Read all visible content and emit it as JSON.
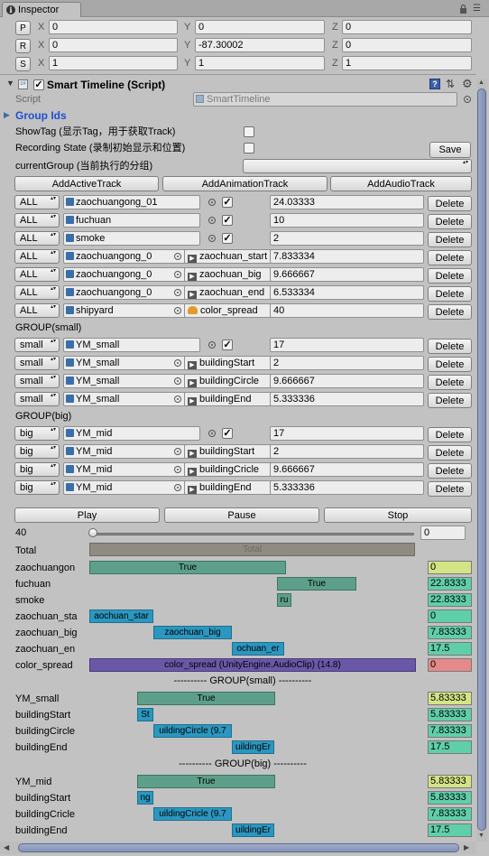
{
  "window": {
    "tab_title": "Inspector"
  },
  "transform": {
    "rows": [
      {
        "button": "P",
        "x": "0",
        "y": "0",
        "z": "0"
      },
      {
        "button": "R",
        "x": "0",
        "y": "-87.30002",
        "z": "0"
      },
      {
        "button": "S",
        "x": "1",
        "y": "1",
        "z": "1"
      }
    ],
    "x_label": "X",
    "y_label": "Y",
    "z_label": "Z"
  },
  "component": {
    "title": "Smart Timeline (Script)",
    "script_label": "Script",
    "script_value": "SmartTimeline",
    "group_ids_label": "Group Ids",
    "show_tag_label": "ShowTag (显示Tag，用于获取Track)",
    "recording_label": "Recording State (录制初始显示和位置)",
    "save_label": "Save",
    "current_group_label": "currentGroup (当前执行的分组)",
    "current_group_value": ""
  },
  "add_buttons": [
    "AddActiveTrack",
    "AddAnimationTrack",
    "AddAudioTrack"
  ],
  "delete_label": "Delete",
  "tracks_all": [
    {
      "group": "ALL",
      "object": "zaochuangong_01",
      "checked": true,
      "clip": "",
      "value": "24.03333"
    },
    {
      "group": "ALL",
      "object": "fuchuan",
      "checked": true,
      "clip": "",
      "value": "10"
    },
    {
      "group": "ALL",
      "object": "smoke",
      "checked": true,
      "clip": "",
      "value": "2"
    },
    {
      "group": "ALL",
      "object": "zaochuangong_0",
      "clip": "zaochuan_start",
      "value": "7.833334",
      "kind": "anim"
    },
    {
      "group": "ALL",
      "object": "zaochuangong_0",
      "clip": "zaochuan_big",
      "value": "9.666667",
      "kind": "anim"
    },
    {
      "group": "ALL",
      "object": "zaochuangong_0",
      "clip": "zaochuan_end",
      "value": "6.533334",
      "kind": "anim"
    },
    {
      "group": "ALL",
      "object": "shipyard",
      "clip": "color_spread",
      "value": "40",
      "kind": "audio"
    }
  ],
  "group_small_title": "GROUP(small)",
  "tracks_small": [
    {
      "group": "small",
      "object": "YM_small",
      "checked": true,
      "value": "17"
    },
    {
      "group": "small",
      "object": "YM_small",
      "clip": "buildingStart",
      "value": "2",
      "kind": "anim"
    },
    {
      "group": "small",
      "object": "YM_small",
      "clip": "buildingCircle",
      "value": "9.666667",
      "kind": "anim"
    },
    {
      "group": "small",
      "object": "YM_small",
      "clip": "buildingEnd",
      "value": "5.333336",
      "kind": "anim"
    }
  ],
  "group_big_title": "GROUP(big)",
  "tracks_big": [
    {
      "group": "big",
      "object": "YM_mid",
      "checked": true,
      "value": "17"
    },
    {
      "group": "big",
      "object": "YM_mid",
      "clip": "buildingStart",
      "value": "2",
      "kind": "anim"
    },
    {
      "group": "big",
      "object": "YM_mid",
      "clip": "buildingCricle",
      "value": "9.666667",
      "kind": "anim"
    },
    {
      "group": "big",
      "object": "YM_mid",
      "clip": "buildingEnd",
      "value": "5.333336",
      "kind": "anim"
    }
  ],
  "controls": {
    "play": "Play",
    "pause": "Pause",
    "stop": "Stop",
    "time_label": "40",
    "time_value": "0"
  },
  "timeline": {
    "total_label": "Total",
    "total_bar": "Total",
    "rows_all": [
      {
        "label": "zaochuangon",
        "bar": "True",
        "value": "0"
      },
      {
        "label": "fuchuan",
        "bar": "True",
        "value": "22.8333"
      },
      {
        "label": "smoke",
        "bar": "ru",
        "value": "22.8333"
      },
      {
        "label": "zaochuan_sta",
        "bar": "aochuan_star",
        "value": "0"
      },
      {
        "label": "zaochuan_big",
        "bar": "zaochuan_big",
        "value": "7.83333"
      },
      {
        "label": "zaochuan_en",
        "bar": "ochuan_er",
        "value": "17.5"
      },
      {
        "label": "color_spread",
        "bar": "color_spread (UnityEngine.AudioClip) (14.8)",
        "value": "0"
      }
    ],
    "small_sep": "---------- GROUP(small) ----------",
    "rows_small": [
      {
        "label": "YM_small",
        "bar": "True",
        "value": "5.83333"
      },
      {
        "label": "buildingStart",
        "bar": "St",
        "value": "5.83333"
      },
      {
        "label": "buildingCircle",
        "bar": "uildingCircle (9.7",
        "value": "7.83333"
      },
      {
        "label": "buildingEnd",
        "bar": "uildingEr",
        "value": "17.5"
      }
    ],
    "big_sep": "---------- GROUP(big) ----------",
    "rows_big": [
      {
        "label": "YM_mid",
        "bar": "True",
        "value": "5.83333"
      },
      {
        "label": "buildingStart",
        "bar": "ng",
        "value": "5.83333"
      },
      {
        "label": "buildingCricle",
        "bar": "uildingCricle (9.7",
        "value": "7.83333"
      },
      {
        "label": "buildingEnd",
        "bar": "uildingEr",
        "value": "17.5"
      }
    ]
  },
  "colors": {
    "active_bar": "#5d9f8a",
    "anim_bar": "#2b97c0",
    "audio_bar": "#6b57a8",
    "value_yellow": "#d3e486",
    "value_green": "#5fcfaa",
    "value_red": "#e58a8a"
  }
}
